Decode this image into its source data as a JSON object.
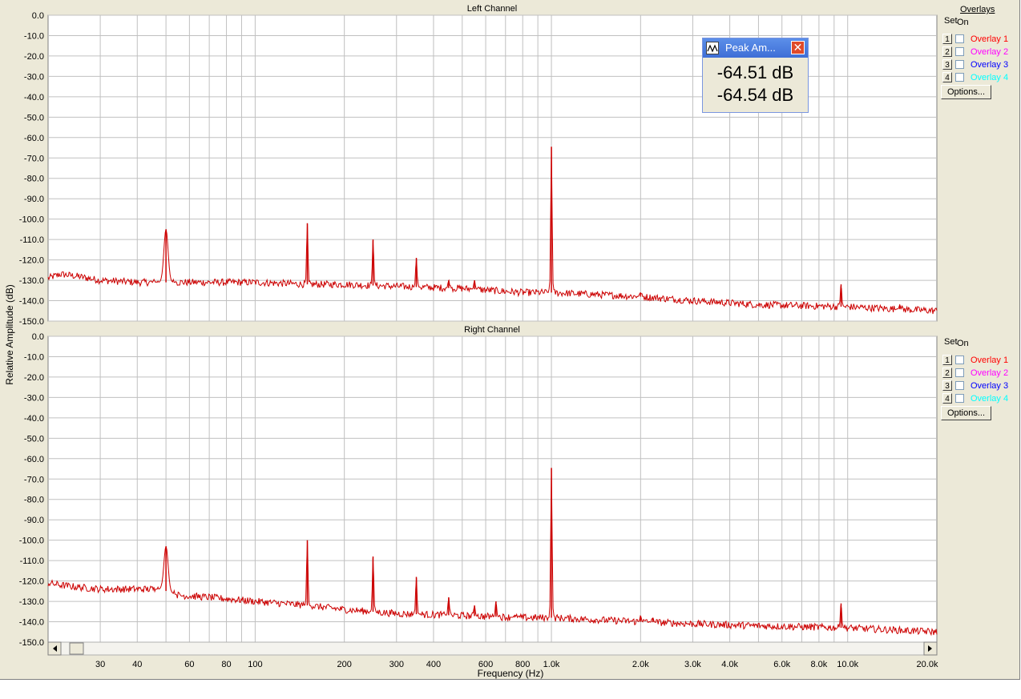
{
  "chart_data": [
    {
      "type": "line",
      "title": "Left Channel",
      "xlabel": "Frequency (Hz)",
      "ylabel": "Relative Amplitude (dB)",
      "x_scale": "log",
      "xlim": [
        20,
        20000
      ],
      "ylim": [
        -150,
        0
      ],
      "grid": true,
      "series": [
        {
          "color": "#cc0000",
          "noise_floor": [
            [
              20,
              -129
            ],
            [
              22,
              -127
            ],
            [
              25,
              -128
            ],
            [
              30,
              -130
            ],
            [
              40,
              -131
            ],
            [
              48,
              -131
            ],
            [
              60,
              -131
            ],
            [
              100,
              -131
            ],
            [
              150,
              -132
            ],
            [
              200,
              -132
            ],
            [
              300,
              -133
            ],
            [
              500,
              -134
            ],
            [
              800,
              -136
            ],
            [
              1000,
              -136
            ],
            [
              2000,
              -138
            ],
            [
              3000,
              -140
            ],
            [
              5000,
              -142
            ],
            [
              10000,
              -143
            ],
            [
              20000,
              -145
            ]
          ],
          "peaks": [
            [
              50,
              -105
            ],
            [
              150,
              -102
            ],
            [
              250,
              -110
            ],
            [
              350,
              -119
            ],
            [
              450,
              -130
            ],
            [
              550,
              -130
            ],
            [
              1000,
              -64.51
            ],
            [
              2000,
              -136
            ],
            [
              9500,
              -132
            ],
            [
              15000,
              -142
            ]
          ]
        }
      ]
    },
    {
      "type": "line",
      "title": "Right Channel",
      "xlabel": "Frequency (Hz)",
      "ylabel": "Relative Amplitude (dB)",
      "x_scale": "log",
      "xlim": [
        20,
        20000
      ],
      "ylim": [
        -150,
        0
      ],
      "grid": true,
      "series": [
        {
          "color": "#cc0000",
          "noise_floor": [
            [
              20,
              -121
            ],
            [
              22,
              -122
            ],
            [
              25,
              -123
            ],
            [
              30,
              -124
            ],
            [
              40,
              -124
            ],
            [
              48,
              -124
            ],
            [
              55,
              -127
            ],
            [
              70,
              -128
            ],
            [
              100,
              -130
            ],
            [
              150,
              -132
            ],
            [
              200,
              -134
            ],
            [
              300,
              -136
            ],
            [
              500,
              -137
            ],
            [
              800,
              -138
            ],
            [
              1000,
              -138
            ],
            [
              2000,
              -140
            ],
            [
              3000,
              -141
            ],
            [
              5000,
              -142
            ],
            [
              10000,
              -143
            ],
            [
              20000,
              -145
            ]
          ],
          "peaks": [
            [
              50,
              -103
            ],
            [
              150,
              -100
            ],
            [
              250,
              -108
            ],
            [
              350,
              -118
            ],
            [
              450,
              -128
            ],
            [
              550,
              -132
            ],
            [
              650,
              -130
            ],
            [
              750,
              -137
            ],
            [
              1000,
              -64.54
            ],
            [
              2000,
              -137
            ],
            [
              2200,
              -138
            ],
            [
              9500,
              -131
            ]
          ]
        }
      ]
    }
  ],
  "axes": {
    "y_ticks": [
      "0.0",
      "-10.0",
      "-20.0",
      "-30.0",
      "-40.0",
      "-50.0",
      "-60.0",
      "-70.0",
      "-80.0",
      "-90.0",
      "-100.0",
      "-110.0",
      "-120.0",
      "-130.0",
      "-140.0",
      "-150.0"
    ],
    "y_tick_values": [
      0,
      -10,
      -20,
      -30,
      -40,
      -50,
      -60,
      -70,
      -80,
      -90,
      -100,
      -110,
      -120,
      -130,
      -140,
      -150
    ],
    "x_ticks": [
      {
        "v": 30,
        "label": "30"
      },
      {
        "v": 40,
        "label": "40"
      },
      {
        "v": 60,
        "label": "60"
      },
      {
        "v": 80,
        "label": "80"
      },
      {
        "v": 100,
        "label": "100"
      },
      {
        "v": 200,
        "label": "200"
      },
      {
        "v": 300,
        "label": "300"
      },
      {
        "v": 400,
        "label": "400"
      },
      {
        "v": 600,
        "label": "600"
      },
      {
        "v": 800,
        "label": "800"
      },
      {
        "v": 1000,
        "label": "1.0k"
      },
      {
        "v": 2000,
        "label": "2.0k"
      },
      {
        "v": 3000,
        "label": "3.0k"
      },
      {
        "v": 4000,
        "label": "4.0k"
      },
      {
        "v": 6000,
        "label": "6.0k"
      },
      {
        "v": 8000,
        "label": "8.0k"
      },
      {
        "v": 10000,
        "label": "10.0k"
      },
      {
        "v": 20000,
        "label": "20.0k"
      }
    ]
  },
  "peak_window": {
    "title": "Peak Am...",
    "left_value": "-64.51 dB",
    "right_value": "-64.54 dB",
    "icon": "waveform-icon"
  },
  "overlays_panel": {
    "title": "Overlays",
    "set_header": "Set",
    "on_header": "On",
    "items": [
      {
        "num": "1",
        "label": "Overlay 1",
        "color": "#ff0000"
      },
      {
        "num": "2",
        "label": "Overlay 2",
        "color": "#ff00ff"
      },
      {
        "num": "3",
        "label": "Overlay 3",
        "color": "#0000ff"
      },
      {
        "num": "4",
        "label": "Overlay 4",
        "color": "#00ffff"
      }
    ],
    "options_label": "Options..."
  }
}
